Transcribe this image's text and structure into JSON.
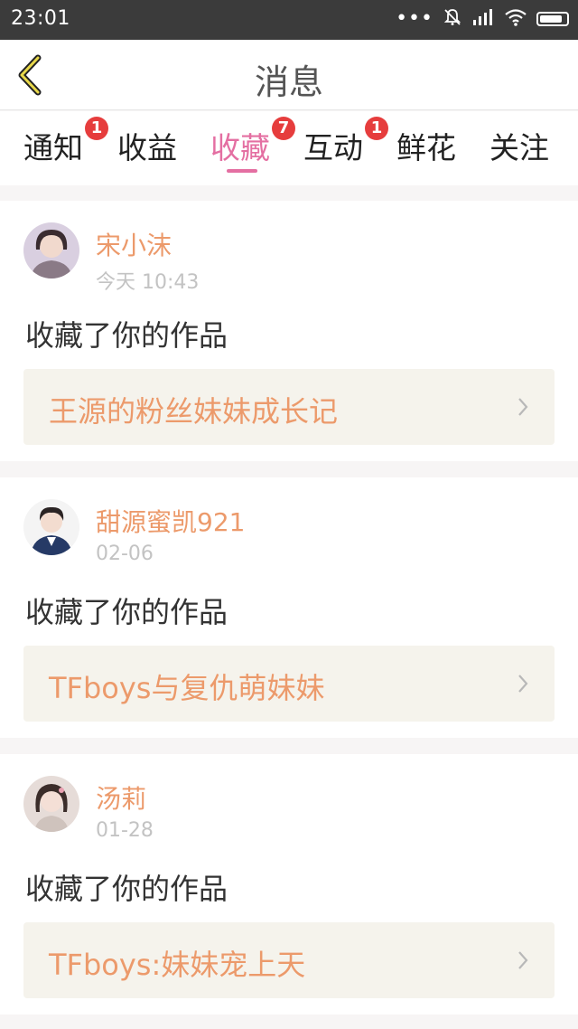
{
  "status_bar": {
    "time": "23:01"
  },
  "header": {
    "title": "消息"
  },
  "tabs": [
    {
      "label": "通知",
      "badge": "1"
    },
    {
      "label": "收益",
      "badge": ""
    },
    {
      "label": "收藏",
      "badge": "7"
    },
    {
      "label": "互动",
      "badge": "1"
    },
    {
      "label": "鲜花",
      "badge": ""
    },
    {
      "label": "关注",
      "badge": ""
    }
  ],
  "active_tab": "收藏",
  "messages": [
    {
      "user": "宋小沫",
      "time": "今天 10:43",
      "action": "收藏了你的作品",
      "work_title": "王源的粉丝妹妹成长记"
    },
    {
      "user": "甜源蜜凯921",
      "time": "02-06",
      "action": "收藏了你的作品",
      "work_title": "TFboys与复仇萌妹妹"
    },
    {
      "user": "汤莉",
      "time": "01-28",
      "action": "收藏了你的作品",
      "work_title": "TFboys:妹妹宠上天"
    }
  ],
  "colors": {
    "accent": "#e46fa2",
    "name": "#ec9a6b",
    "badge": "#e63d3d",
    "status_bar": "#3b3b3b"
  }
}
